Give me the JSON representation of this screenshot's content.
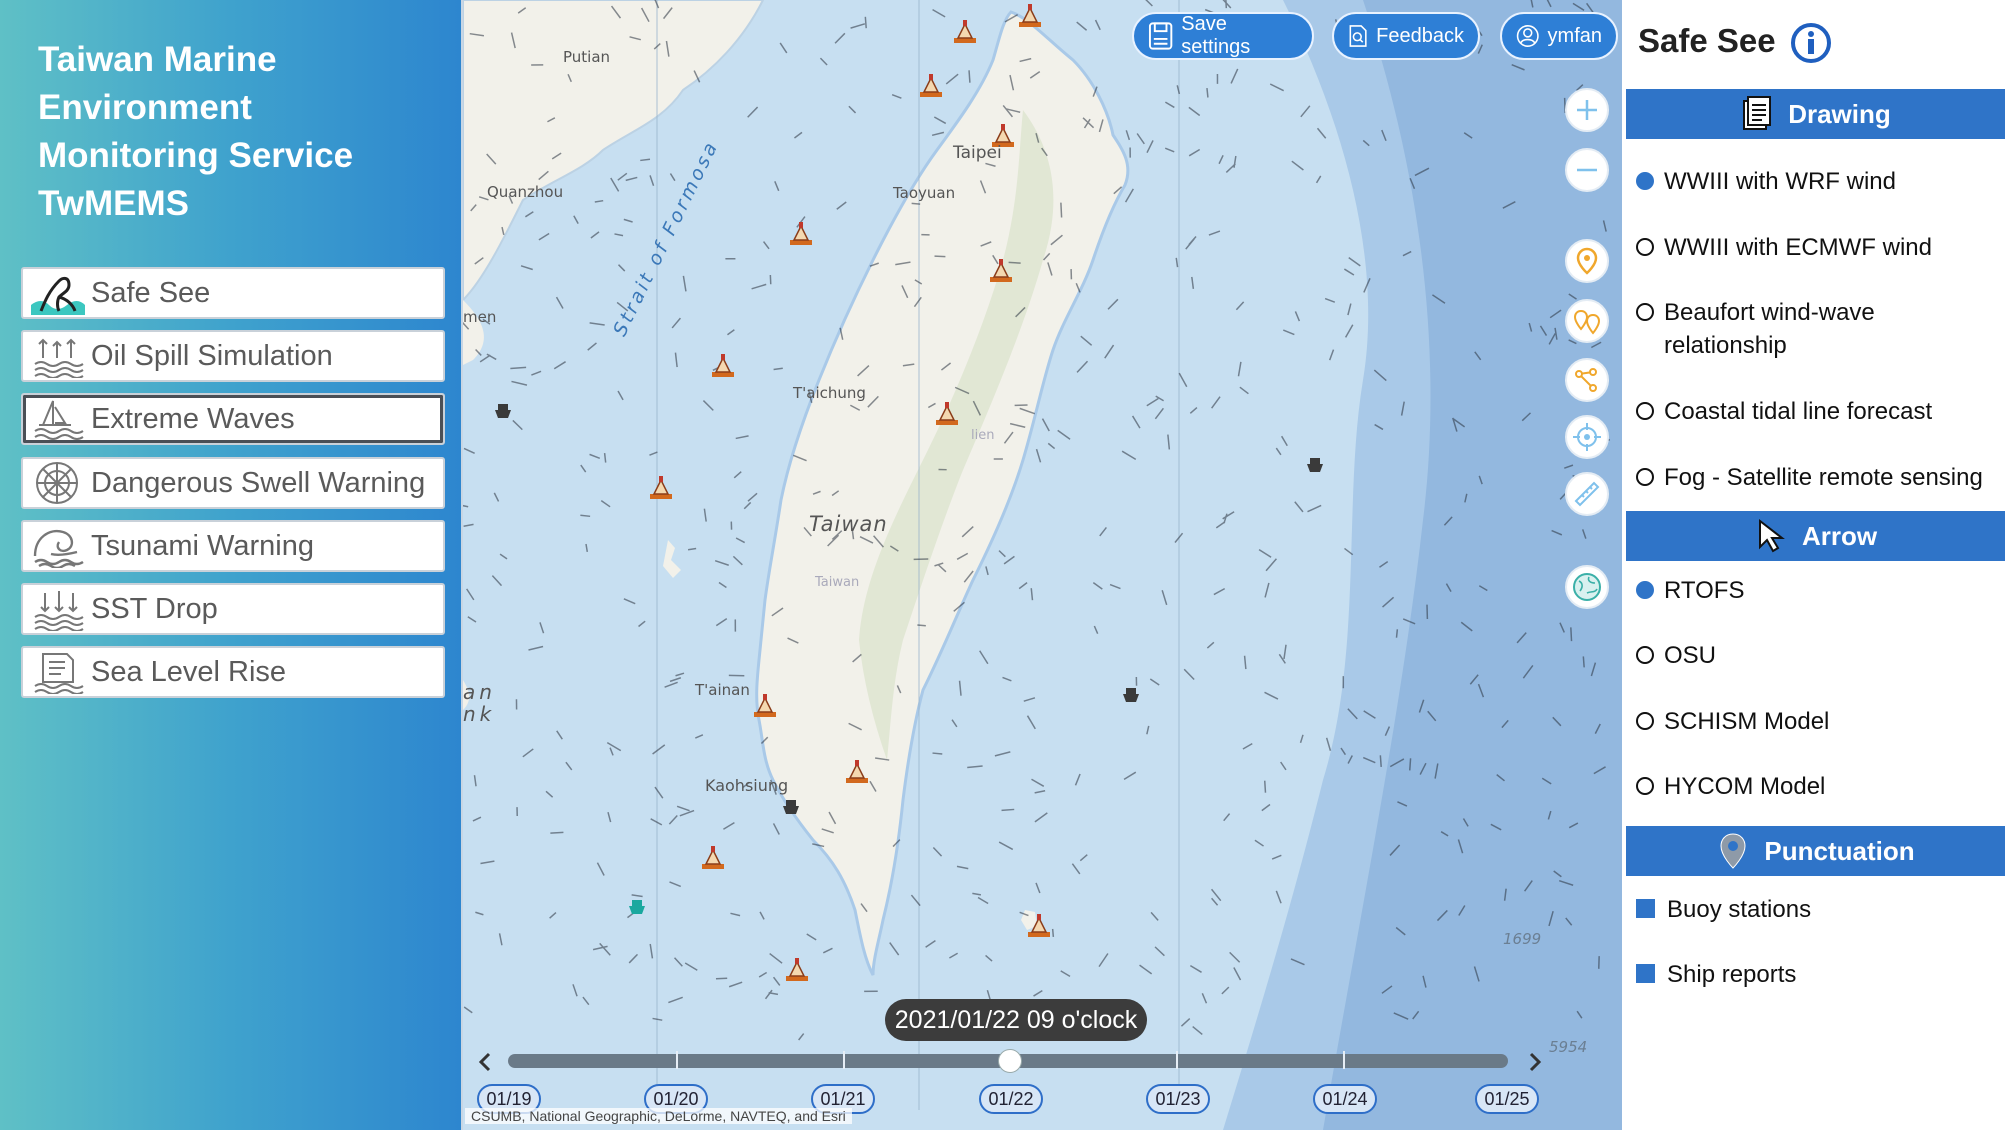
{
  "app": {
    "title_lines": [
      "Taiwan Marine",
      "Environment",
      "Monitoring Service",
      "TwMEMS"
    ],
    "menu": [
      {
        "label": "Safe See",
        "icon": "safe-see-icon",
        "active": false
      },
      {
        "label": "Oil Spill Simulation",
        "icon": "oil-spill-icon",
        "active": false
      },
      {
        "label": "Extreme Waves",
        "icon": "extreme-waves-icon",
        "active": true
      },
      {
        "label": "Dangerous Swell Warning",
        "icon": "swell-warning-icon",
        "active": false
      },
      {
        "label": "Tsunami Warning",
        "icon": "tsunami-icon",
        "active": false
      },
      {
        "label": "SST Drop",
        "icon": "sst-drop-icon",
        "active": false
      },
      {
        "label": "Sea Level Rise",
        "icon": "sea-level-icon",
        "active": false
      }
    ]
  },
  "toolbar": {
    "save_label": "Save settings",
    "feedback_label": "Feedback",
    "user_label": "ymfan"
  },
  "map": {
    "labels": {
      "putian": "Putian",
      "quanzhou": "Quanzhou",
      "strait": "Strait of Formosa",
      "taipei": "Taipei",
      "taoyuan": "Taoyuan",
      "taichung": "T'aichung",
      "taiwan": "Taiwan",
      "taiwan_small": "Taiwan",
      "tainan": "T'ainan",
      "kaohsiung": "Kaohsiung",
      "depth1": "1699",
      "depth2": "5954",
      "partial_1": "men",
      "partial_2": "an",
      "partial_3": "nk",
      "partial_4": "lien"
    },
    "timestamp": "2021/01/22 09 o'clock",
    "dates": [
      "01/19",
      "01/20",
      "01/21",
      "01/22",
      "01/23",
      "01/24",
      "01/25"
    ],
    "attribution": "CSUMB, National Geographic, DeLorme, NAVTEQ, and Esri",
    "colors": {
      "sea": "#c7dff1",
      "land": "#f2f1ea",
      "button": "#2e7fd6"
    }
  },
  "right_panel": {
    "title": "Safe See",
    "sections": [
      {
        "heading": "Drawing",
        "icon": "document-icon",
        "options": [
          {
            "label": "WWIII with WRF wind",
            "selected": true
          },
          {
            "label": "WWIII with ECMWF wind",
            "selected": false
          },
          {
            "label": "Beaufort wind-wave relationship",
            "selected": false
          },
          {
            "label": "Coastal tidal line forecast",
            "selected": false
          },
          {
            "label": "Fog - Satellite remote sensing",
            "selected": false
          }
        ]
      },
      {
        "heading": "Arrow",
        "icon": "cursor-icon",
        "options": [
          {
            "label": "RTOFS",
            "selected": true
          },
          {
            "label": "OSU",
            "selected": false
          },
          {
            "label": "SCHISM Model",
            "selected": false
          },
          {
            "label": "HYCOM Model",
            "selected": false
          }
        ]
      },
      {
        "heading": "Punctuation",
        "icon": "pin-icon",
        "options": [
          {
            "label": "Buoy stations",
            "selected": true
          },
          {
            "label": "Ship reports",
            "selected": true
          }
        ]
      }
    ]
  }
}
